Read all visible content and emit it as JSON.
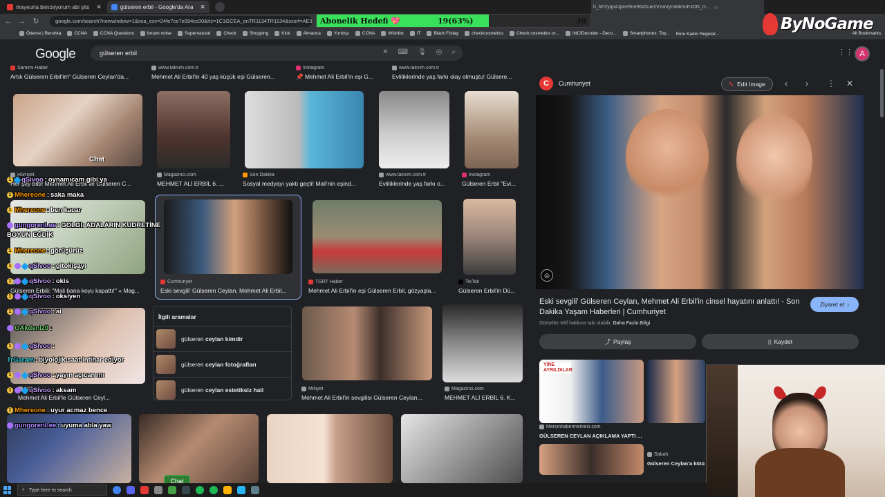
{
  "browser": {
    "tabs": [
      {
        "label": "mayeuria benzeyorum abi şits",
        "color": "#e53935",
        "active": false
      },
      {
        "label": "gülseren erbil - Google'da Ara",
        "color": "#4285f4",
        "active": true
      }
    ],
    "url": "google.com/search?newwindow=1&sca_esv=24fe7ce7e994cc00&rlz=1C1GCEA_enTR1134TR1134&sxsrf=AE3TifMyWF9s4",
    "url_right": "h_bFZyqo4JpnHSre36zGue2VzwVym94moFJON_D...",
    "bookmarks": [
      "Ödeme | Bershka",
      "CCNA",
      "CCNA Questions",
      "brown noise",
      "Supernatural",
      "Check",
      "Shopping",
      "Kick",
      "Almanca",
      "Yurtdışı",
      "CCNA",
      "Wishlist",
      "IT",
      "Black Friday",
      "checkcosmetics",
      "Check cosmetics or...",
      "INCIDecoder - Deco...",
      "Smartphones: Top..."
    ],
    "bookmarks_right": "Ekru Kadın Regular...",
    "all_bookmarks": "All Bookmarks"
  },
  "stream": {
    "sub_title": "Abonelik Hedefi 💖",
    "sub_count": "19(63%)",
    "sub_goal": "30",
    "sub_progress": 0.63,
    "channel_logo": "ByNoGame",
    "chat_label": "Chat",
    "chat_button": "Chat",
    "chat": [
      {
        "user": "qSivoo",
        "text": "oynamıcam gibi ya",
        "color": "#c9a3ff",
        "badges": [
          "y",
          "b"
        ]
      },
      {
        "user": "Mhereone",
        "text": "saka maka",
        "color": "#ff9d00",
        "badges": [
          "y"
        ]
      },
      {
        "user": "Mhereone",
        "text": "ben kacar",
        "color": "#ff9d00",
        "badges": [
          "y"
        ]
      },
      {
        "user": "gungorenLee",
        "text": "GOLGI: ADALARIN KUDRETİNE",
        "color": "#b088ff",
        "badges": [
          "p"
        ]
      },
      {
        "user": "",
        "text": "BOYUN EĞDİK",
        "color": "#fff",
        "badges": []
      },
      {
        "user": "Mhereone",
        "text": "görüşürüz",
        "color": "#ff9d00",
        "badges": [
          "y"
        ]
      },
      {
        "user": "qSivoo",
        "text": "gitokişayı",
        "color": "#c9a3ff",
        "badges": [
          "y",
          "p",
          "b"
        ]
      },
      {
        "user": "qSivoo",
        "text": "okis",
        "color": "#c9a3ff",
        "badges": [
          "y",
          "p",
          "b"
        ]
      },
      {
        "user": "qSivoo",
        "text": "oksiyen",
        "color": "#c9a3ff",
        "badges": [
          "y",
          "p",
          "b"
        ]
      },
      {
        "user": "qSivoo",
        "text": "ai",
        "color": "#c9a3ff",
        "badges": [
          "y",
          "p",
          "b"
        ]
      },
      {
        "user": "OAkdeniz0",
        "text": "",
        "color": "#6fd16f",
        "badges": [
          "p"
        ]
      },
      {
        "user": "qSivoo",
        "text": "",
        "color": "#c9a3ff",
        "badges": [
          "y",
          "p",
          "b"
        ]
      },
      {
        "user": "TrGaram",
        "text": "biyolojik saat intihar ediyor",
        "color": "#3bd8e6",
        "badges": []
      },
      {
        "user": "qSivoo",
        "text": "yayın açıcan mı",
        "color": "#c9a3ff",
        "badges": [
          "y",
          "p",
          "b"
        ]
      },
      {
        "user": "qSivoo",
        "text": "aksam",
        "color": "#c9a3ff",
        "badges": [
          "y",
          "p",
          "b"
        ]
      },
      {
        "user": "Mhereone",
        "text": "uyur acmaz bence",
        "color": "#ff9d00",
        "badges": [
          "y"
        ]
      },
      {
        "user": "gungorenLee",
        "text": "uyuma abla yaw",
        "color": "#b088ff",
        "badges": [
          "p"
        ]
      }
    ]
  },
  "google": {
    "logo": "Google",
    "query": "gülseren erbil",
    "top_row": [
      {
        "src": "Samimi Haber",
        "title": "Artık Gülseren Erbil'im\" Gülseren Ceylan'da...",
        "color": "#e53935"
      },
      {
        "src": "www.takvim.com.tr",
        "title": "Mehmet Ali Erbil'in 40 yaş küçük eşi Gülseren...",
        "color": "#9aa0a6"
      },
      {
        "src": "Instagram",
        "title": "📌 Mehmet Ali Erbil'in eşi G...",
        "color": "#e1306c"
      },
      {
        "src": "www.takvim.com.tr",
        "title": "Evliliklerinde yaş farkı olay olmuştu! Gülsere...",
        "color": "#9aa0a6"
      }
    ],
    "row2": [
      {
        "src": "Hürriyet",
        "title": "Her şey bitti! Mehmet Ali Erbil ile Gülseren C..."
      },
      {
        "src": "Magazinci.com",
        "title": "MEHMET ALİ ERBİL 6. ..."
      },
      {
        "src": "Son Dakika",
        "title": "Sosyal medyayı yaktı geçti! Mali'nin eşind..."
      },
      {
        "src": "www.takvim.com.tr",
        "title": "Evliliklerinde yaş farkı o..."
      },
      {
        "src": "Instagram",
        "title": "Gülseren Erbil \"Evi..."
      }
    ],
    "row3": [
      {
        "src": "",
        "title": "Gülseren Erbili: \"Mali bana koyu kapattı!\" « Mag..."
      },
      {
        "src": "Cumhuriyet",
        "title": "Eski sevgili' Gülseren Ceylan, Mehmet Ali Erbil..."
      },
      {
        "src": "TGRT Haber",
        "title": "Mehmet Ali Erbil'in eşi Gülseren Erbil, gözyaşla..."
      },
      {
        "src": "TikTok",
        "title": "Gülseren Erbil'in Dü..."
      }
    ],
    "row4": [
      {
        "src": "Milliyet",
        "title": "Mehmet Ali Erbil'in sevgilisi Gülseren Ceylan..."
      },
      {
        "src": "Magazinci.com",
        "title": "MEHMET ALİ ERBİL 6. K..."
      },
      {
        "src": "Milliyet",
        "title": "Mehmet Ali Erbil'le Gülseren Ceyl..."
      }
    ],
    "related": {
      "heading": "İlgili aramalar",
      "items": [
        {
          "prefix": "gülseren ",
          "bold": "ceylan kimdir"
        },
        {
          "prefix": "gülseren ",
          "bold": "ceylan fotoğrafları"
        },
        {
          "prefix": "gülseren ",
          "bold": "ceylan estetiksiz hali"
        }
      ]
    }
  },
  "panel": {
    "source": "Cumhuriyet",
    "source_logo": "C",
    "edit_label": "Edit Image",
    "title": "Eski sevgili' Gülseren Ceylan, Mehmet Ali Erbil'in cinsel hayatını anlattı! - Son Dakika Yaşam Haberleri | Cumhuriyet",
    "note": "Görseller telif hakkına tabi olabilir.",
    "note_link": "Daha Fazla Bilgi",
    "visit_label": "Ziyaret et",
    "share_label": "Paylaş",
    "save_label": "Kaydet",
    "similar": [
      {
        "src": "Mersinhabermerkezi.com",
        "title": "GÜLSEREN CEYLAN AÇIKLAMA YAPTI -...",
        "tag": "YİNE AYRILDILAR"
      },
      {
        "src": "Sabah",
        "title": "Gülseren Ceylan'a kötü"
      }
    ]
  },
  "taskbar": {
    "search_placeholder": "Type here to search"
  }
}
